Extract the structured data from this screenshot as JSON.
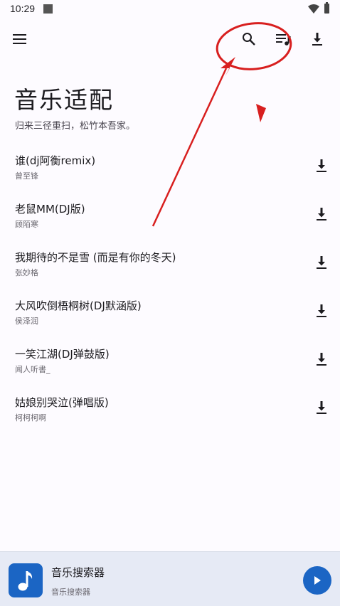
{
  "status_bar": {
    "time": "10:29"
  },
  "header": {
    "menu_icon": "menu-icon",
    "search_icon": "search-icon",
    "queue_icon": "queue-music-icon",
    "download_icon": "download-icon"
  },
  "page": {
    "title": "音乐适配",
    "subtitle": "归来三径重扫，松竹本吾家。"
  },
  "songs": [
    {
      "title": "谁(dj阿衡remix)",
      "artist": "曾至锋"
    },
    {
      "title": "老鼠MM(DJ版)",
      "artist": "顾陌寒"
    },
    {
      "title": "我期待的不是雪 (而是有你的冬天)",
      "artist": "张妙格"
    },
    {
      "title": "大风吹倒梧桐树(DJ默涵版)",
      "artist": "侯泽润"
    },
    {
      "title": "一笑江湖(DJ弹鼓版)",
      "artist": "闻人听書_"
    },
    {
      "title": "姑娘别哭泣(弹唱版)",
      "artist": "柯柯柯啊"
    }
  ],
  "player": {
    "title": "音乐搜索器",
    "subtitle": "音乐搜索器",
    "icon": "music-note-icon",
    "play_icon": "play-icon"
  },
  "colors": {
    "background": "#fdfbff",
    "accent": "#1b65c4",
    "player_bar": "#e6eaf5",
    "annotation": "#d81f1f"
  }
}
